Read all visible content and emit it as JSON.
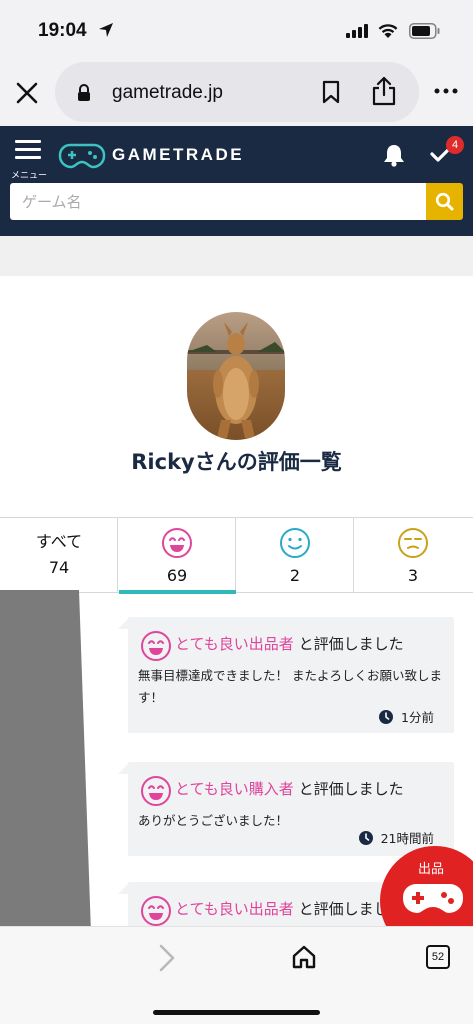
{
  "status_bar": {
    "time": "19:04"
  },
  "browser": {
    "url": "gametrade.jp"
  },
  "header": {
    "menu_label": "メニュー",
    "logo_text": "GAMETRADE",
    "todo_badge": "4",
    "search_placeholder": "ゲーム名"
  },
  "profile": {
    "title": "Rickyさんの評価一覧"
  },
  "tabs": [
    {
      "label": "すべて",
      "count": "74",
      "face": "none"
    },
    {
      "label": "",
      "count": "69",
      "face": "good",
      "color": "#e0459c"
    },
    {
      "label": "",
      "count": "2",
      "face": "normal",
      "color": "#2aa9c8"
    },
    {
      "label": "",
      "count": "3",
      "face": "bad",
      "color": "#c9a21a"
    }
  ],
  "active_tab_accent": "#2fb9bd",
  "reviews": [
    {
      "rating": "とても良い出品者",
      "suffix": "と評価しました",
      "body": "無事目標達成できました！ またよろしくお願い致します！",
      "time": "1分前"
    },
    {
      "rating": "とても良い購入者",
      "suffix": "と評価しました",
      "body": "ありがとうございました！",
      "time": "21時間前"
    },
    {
      "rating": "とても良い出品者",
      "suffix": "と評価しました",
      "body": "",
      "time": ""
    }
  ],
  "sell_button": {
    "label": "出品"
  },
  "toolbar": {
    "tab_count": "52"
  },
  "colors": {
    "header_bg": "#1b2a43",
    "search_button": "#e6b400",
    "rating_pink": "#e0459c",
    "sell_red": "#e02222",
    "badge_red": "#e02b2b"
  }
}
